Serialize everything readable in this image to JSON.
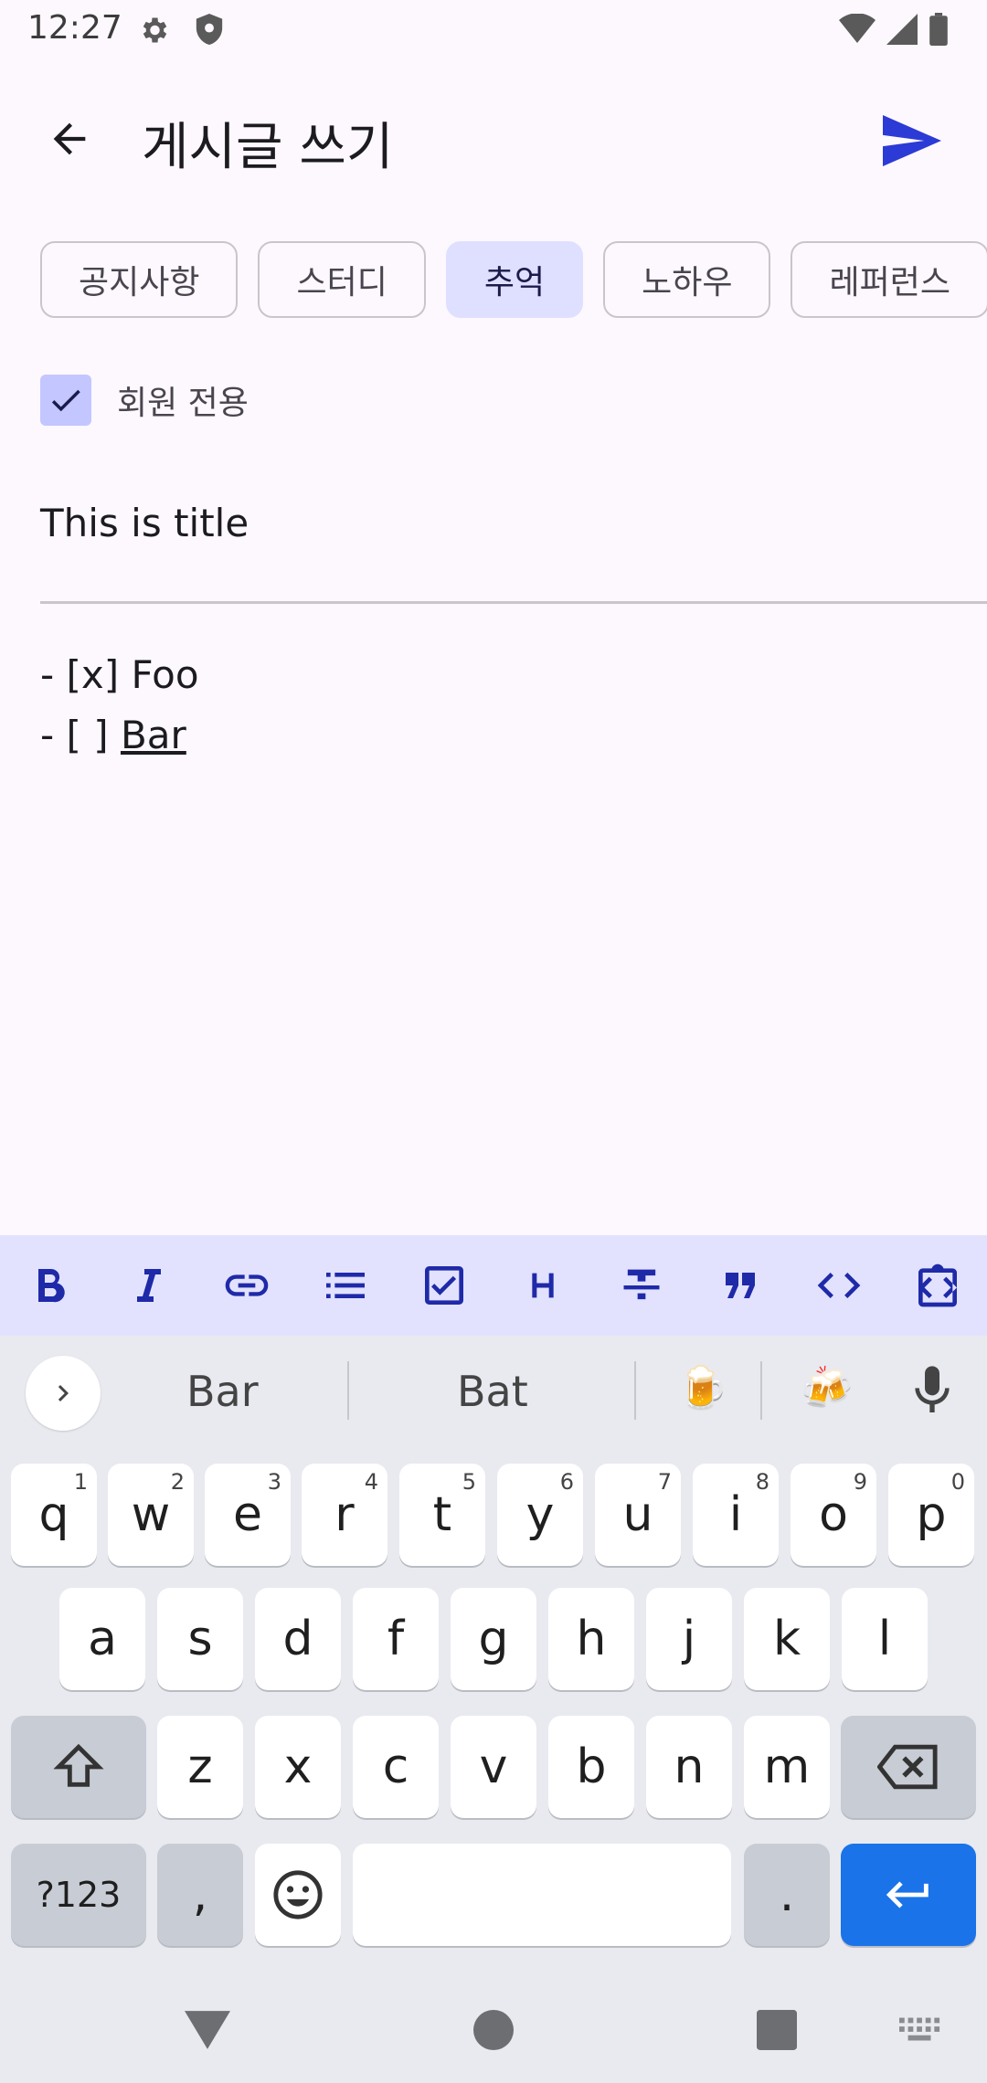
{
  "status": {
    "time": "12:27"
  },
  "app_bar": {
    "title": "게시글 쓰기"
  },
  "categories": [
    "공지사항",
    "스터디",
    "추억",
    "노하우",
    "레퍼런스"
  ],
  "selected_category": "추억",
  "members_only": {
    "label": "회원 전용",
    "checked": true
  },
  "post": {
    "title": "This is title",
    "body_line1": "- [x] Foo",
    "body_line2_prefix": "- [ ] ",
    "body_line2_word": "Bar"
  },
  "format_toolbar": [
    "bold-icon",
    "italic-icon",
    "link-icon",
    "bulleted-list-icon",
    "checkbox-icon",
    "heading-icon",
    "strikethrough-icon",
    "quote-icon",
    "code-icon",
    "code-block-icon"
  ],
  "keyboard": {
    "suggestions": [
      "Bar",
      "Bat"
    ],
    "emoji_suggestions": [
      "🍺",
      "🍻"
    ],
    "row1": [
      [
        "q",
        "1"
      ],
      [
        "w",
        "2"
      ],
      [
        "e",
        "3"
      ],
      [
        "r",
        "4"
      ],
      [
        "t",
        "5"
      ],
      [
        "y",
        "6"
      ],
      [
        "u",
        "7"
      ],
      [
        "i",
        "8"
      ],
      [
        "o",
        "9"
      ],
      [
        "p",
        "0"
      ]
    ],
    "row2": [
      "a",
      "s",
      "d",
      "f",
      "g",
      "h",
      "j",
      "k",
      "l"
    ],
    "row3": [
      "z",
      "x",
      "c",
      "v",
      "b",
      "n",
      "m"
    ],
    "symbols_label": "?123",
    "comma": ",",
    "period": "."
  },
  "colors": {
    "accent": "#2c3ad6",
    "chip_selected": "#dfe0ff",
    "toolbar_bg": "#e2e2ff",
    "enter_key": "#1a73e8"
  }
}
